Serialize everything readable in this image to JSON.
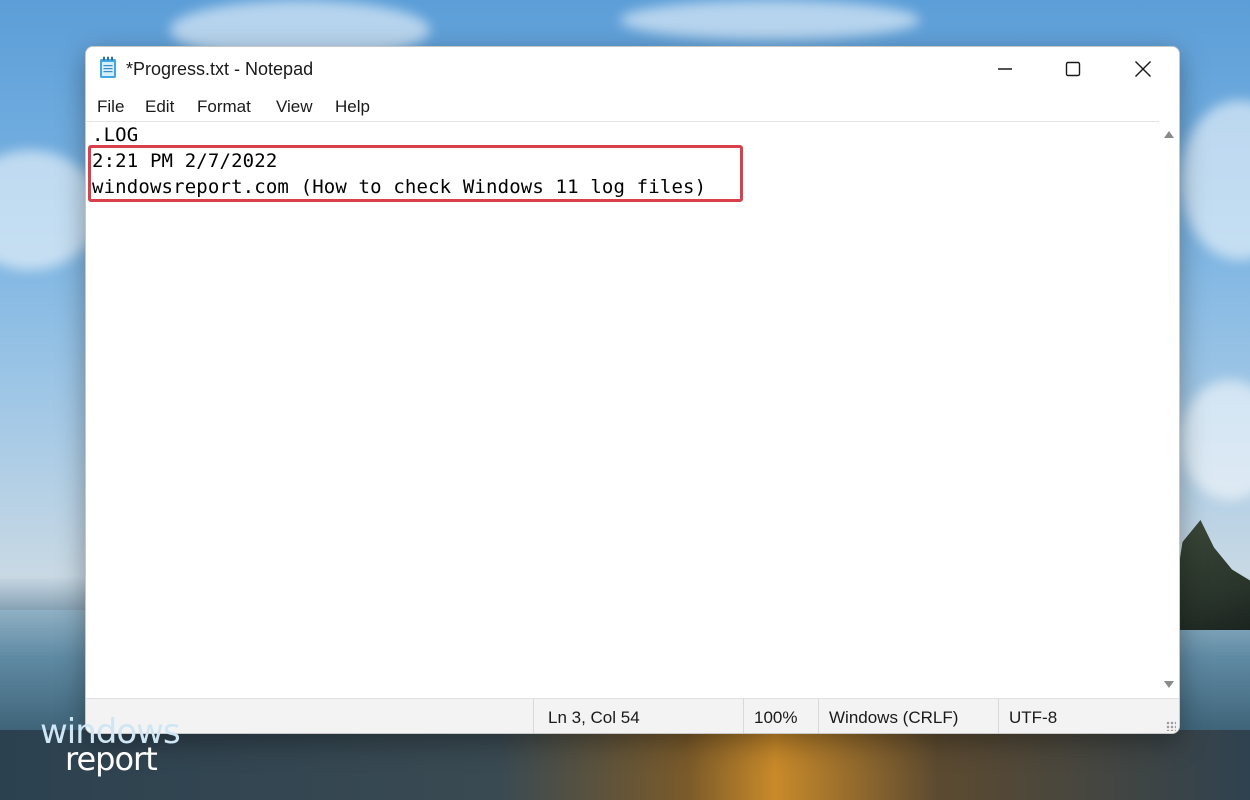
{
  "window": {
    "title": "*Progress.txt - Notepad",
    "icon": "notepad-icon",
    "controls": {
      "minimize": "minimize-icon",
      "maximize": "maximize-icon",
      "close": "close-icon"
    }
  },
  "menu": {
    "file": "File",
    "edit": "Edit",
    "format": "Format",
    "view": "View",
    "help": "Help"
  },
  "editor": {
    "lines": [
      ".LOG",
      "2:21 PM 2/7/2022",
      "windowsreport.com (How to check Windows 11 log files)"
    ],
    "highlight_color": "#d9404b"
  },
  "status": {
    "position": "Ln 3, Col 54",
    "zoom": "100%",
    "line_ending": "Windows (CRLF)",
    "encoding": "UTF-8"
  },
  "watermark": {
    "line1": "windows",
    "line2": "report"
  }
}
